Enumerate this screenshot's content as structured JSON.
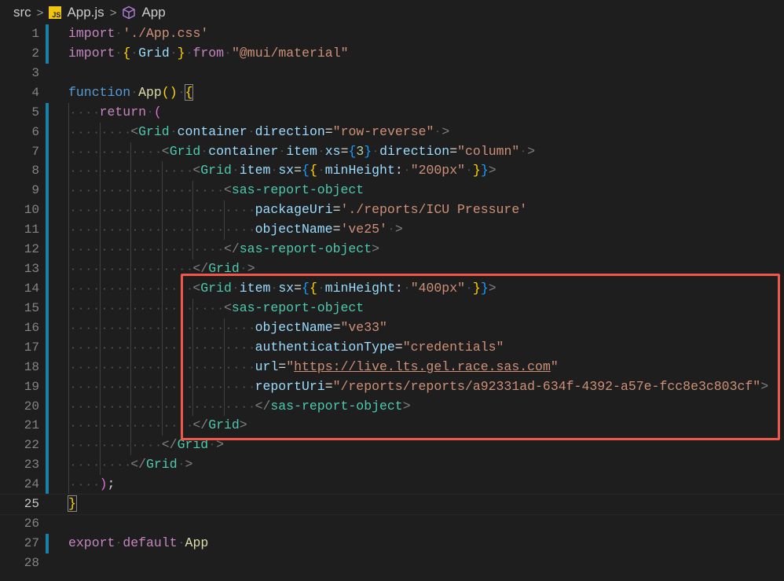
{
  "breadcrumb": {
    "folder": "src",
    "file": "App.js",
    "file_icon": "JS",
    "symbol": "App"
  },
  "lines": [
    {
      "n": "1",
      "i": 0,
      "m": 1,
      "t": [
        [
          "k",
          "import"
        ],
        [
          "ws",
          " "
        ],
        [
          "s",
          "'./App.css'"
        ]
      ]
    },
    {
      "n": "2",
      "i": 0,
      "m": 1,
      "t": [
        [
          "k",
          "import"
        ],
        [
          "ws",
          " "
        ],
        [
          "b1",
          "{"
        ],
        [
          "ws",
          " "
        ],
        [
          "a",
          "Grid"
        ],
        [
          "ws",
          " "
        ],
        [
          "b1",
          "}"
        ],
        [
          "ws",
          " "
        ],
        [
          "k",
          "from"
        ],
        [
          "ws",
          " "
        ],
        [
          "s",
          "\"@mui/material\""
        ]
      ]
    },
    {
      "n": "3",
      "i": 0,
      "m": 0,
      "t": []
    },
    {
      "n": "4",
      "i": 0,
      "m": 0,
      "t": [
        [
          "f",
          "function"
        ],
        [
          "ws",
          " "
        ],
        [
          "fn",
          "App"
        ],
        [
          "b1",
          "()"
        ],
        [
          "ws",
          " "
        ],
        [
          "b1 bm",
          "{"
        ]
      ]
    },
    {
      "n": "5",
      "i": 1,
      "m": 1,
      "t": [
        [
          "k",
          "return"
        ],
        [
          "ws",
          " "
        ],
        [
          "b2",
          "("
        ]
      ]
    },
    {
      "n": "6",
      "i": 2,
      "m": 1,
      "t": [
        [
          "p",
          "<"
        ],
        [
          "t",
          "Grid"
        ],
        [
          "ws",
          " "
        ],
        [
          "a",
          "container"
        ],
        [
          "ws",
          " "
        ],
        [
          "a",
          "direction"
        ],
        [
          "d",
          "="
        ],
        [
          "s",
          "\"row-reverse\""
        ],
        [
          "ws",
          " "
        ],
        [
          "p",
          ">"
        ]
      ]
    },
    {
      "n": "7",
      "i": 3,
      "m": 1,
      "t": [
        [
          "p",
          "<"
        ],
        [
          "t",
          "Grid"
        ],
        [
          "ws",
          " "
        ],
        [
          "a",
          "container"
        ],
        [
          "ws",
          " "
        ],
        [
          "a",
          "item"
        ],
        [
          "ws",
          " "
        ],
        [
          "a",
          "xs"
        ],
        [
          "d",
          "="
        ],
        [
          "b3",
          "{"
        ],
        [
          "n",
          "3"
        ],
        [
          "b3",
          "}"
        ],
        [
          "ws",
          " "
        ],
        [
          "a",
          "direction"
        ],
        [
          "d",
          "="
        ],
        [
          "s",
          "\"column\""
        ],
        [
          "ws",
          " "
        ],
        [
          "p",
          ">"
        ]
      ]
    },
    {
      "n": "8",
      "i": 4,
      "m": 1,
      "t": [
        [
          "p",
          "<"
        ],
        [
          "t",
          "Grid"
        ],
        [
          "ws",
          " "
        ],
        [
          "a",
          "item"
        ],
        [
          "ws",
          " "
        ],
        [
          "a",
          "sx"
        ],
        [
          "d",
          "="
        ],
        [
          "b3",
          "{"
        ],
        [
          "b1",
          "{"
        ],
        [
          "ws",
          " "
        ],
        [
          "a",
          "minHeight"
        ],
        [
          "d",
          ":"
        ],
        [
          "ws",
          " "
        ],
        [
          "s",
          "\"200px\""
        ],
        [
          "ws",
          " "
        ],
        [
          "b1",
          "}"
        ],
        [
          "b3",
          "}"
        ],
        [
          "p",
          ">"
        ]
      ]
    },
    {
      "n": "9",
      "i": 5,
      "m": 1,
      "t": [
        [
          "p",
          "<"
        ],
        [
          "t",
          "sas-report-object"
        ]
      ]
    },
    {
      "n": "10",
      "i": 6,
      "m": 1,
      "t": [
        [
          "a",
          "packageUri"
        ],
        [
          "d",
          "="
        ],
        [
          "s",
          "'./reports/ICU Pressure'"
        ]
      ]
    },
    {
      "n": "11",
      "i": 6,
      "m": 1,
      "t": [
        [
          "a",
          "objectName"
        ],
        [
          "d",
          "="
        ],
        [
          "s",
          "'ve25'"
        ],
        [
          "ws",
          " "
        ],
        [
          "p",
          ">"
        ]
      ]
    },
    {
      "n": "12",
      "i": 5,
      "m": 1,
      "t": [
        [
          "p",
          "</"
        ],
        [
          "t",
          "sas-report-object"
        ],
        [
          "p",
          ">"
        ]
      ]
    },
    {
      "n": "13",
      "i": 4,
      "m": 1,
      "t": [
        [
          "p",
          "</"
        ],
        [
          "t",
          "Grid"
        ],
        [
          "ws",
          " "
        ],
        [
          "p",
          ">"
        ]
      ]
    },
    {
      "n": "14",
      "i": 4,
      "m": 1,
      "t": [
        [
          "p",
          "<"
        ],
        [
          "t",
          "Grid"
        ],
        [
          "ws",
          " "
        ],
        [
          "a",
          "item"
        ],
        [
          "ws",
          " "
        ],
        [
          "a",
          "sx"
        ],
        [
          "d",
          "="
        ],
        [
          "b3",
          "{"
        ],
        [
          "b1",
          "{"
        ],
        [
          "ws",
          " "
        ],
        [
          "a",
          "minHeight"
        ],
        [
          "d",
          ":"
        ],
        [
          "ws",
          " "
        ],
        [
          "s",
          "\"400px\""
        ],
        [
          "ws",
          " "
        ],
        [
          "b1",
          "}"
        ],
        [
          "b3",
          "}"
        ],
        [
          "p",
          ">"
        ]
      ]
    },
    {
      "n": "15",
      "i": 5,
      "m": 1,
      "t": [
        [
          "p",
          "<"
        ],
        [
          "t",
          "sas-report-object"
        ]
      ]
    },
    {
      "n": "16",
      "i": 6,
      "m": 1,
      "t": [
        [
          "a",
          "objectName"
        ],
        [
          "d",
          "="
        ],
        [
          "s",
          "\"ve33\""
        ]
      ]
    },
    {
      "n": "17",
      "i": 6,
      "m": 1,
      "t": [
        [
          "a",
          "authenticationType"
        ],
        [
          "d",
          "="
        ],
        [
          "s",
          "\"credentials\""
        ]
      ]
    },
    {
      "n": "18",
      "i": 6,
      "m": 1,
      "t": [
        [
          "a",
          "url"
        ],
        [
          "d",
          "="
        ],
        [
          "s",
          "\""
        ],
        [
          "u",
          "https://live.lts.gel.race.sas.com"
        ],
        [
          "s",
          "\""
        ]
      ]
    },
    {
      "n": "19",
      "i": 6,
      "m": 1,
      "t": [
        [
          "a",
          "reportUri"
        ],
        [
          "d",
          "="
        ],
        [
          "s",
          "\"/reports/reports/a92331ad-634f-4392-a57e-fcc8e3c803cf\""
        ],
        [
          "p",
          ">"
        ]
      ]
    },
    {
      "n": "20",
      "i": 6,
      "m": 1,
      "t": [
        [
          "p",
          "</"
        ],
        [
          "t",
          "sas-report-object"
        ],
        [
          "p",
          ">"
        ]
      ]
    },
    {
      "n": "21",
      "i": 4,
      "m": 1,
      "t": [
        [
          "p",
          "</"
        ],
        [
          "t",
          "Grid"
        ],
        [
          "p",
          ">"
        ]
      ]
    },
    {
      "n": "22",
      "i": 3,
      "m": 1,
      "t": [
        [
          "p",
          "</"
        ],
        [
          "t",
          "Grid"
        ],
        [
          "ws",
          " "
        ],
        [
          "p",
          ">"
        ]
      ]
    },
    {
      "n": "23",
      "i": 2,
      "m": 1,
      "t": [
        [
          "p",
          "</"
        ],
        [
          "t",
          "Grid"
        ],
        [
          "ws",
          " "
        ],
        [
          "p",
          ">"
        ]
      ]
    },
    {
      "n": "24",
      "i": 1,
      "m": 1,
      "t": [
        [
          "b2",
          ")"
        ],
        [
          "d",
          ";"
        ]
      ]
    },
    {
      "n": "25",
      "i": 0,
      "m": 0,
      "cur": 1,
      "t": [
        [
          "b1 bm",
          "}"
        ]
      ]
    },
    {
      "n": "26",
      "i": 0,
      "m": 0,
      "t": []
    },
    {
      "n": "27",
      "i": 0,
      "m": 1,
      "t": [
        [
          "k",
          "export"
        ],
        [
          "ws",
          " "
        ],
        [
          "k",
          "default"
        ],
        [
          "ws",
          " "
        ],
        [
          "fn",
          "App"
        ]
      ]
    },
    {
      "n": "28",
      "i": 0,
      "m": 0,
      "t": []
    }
  ]
}
